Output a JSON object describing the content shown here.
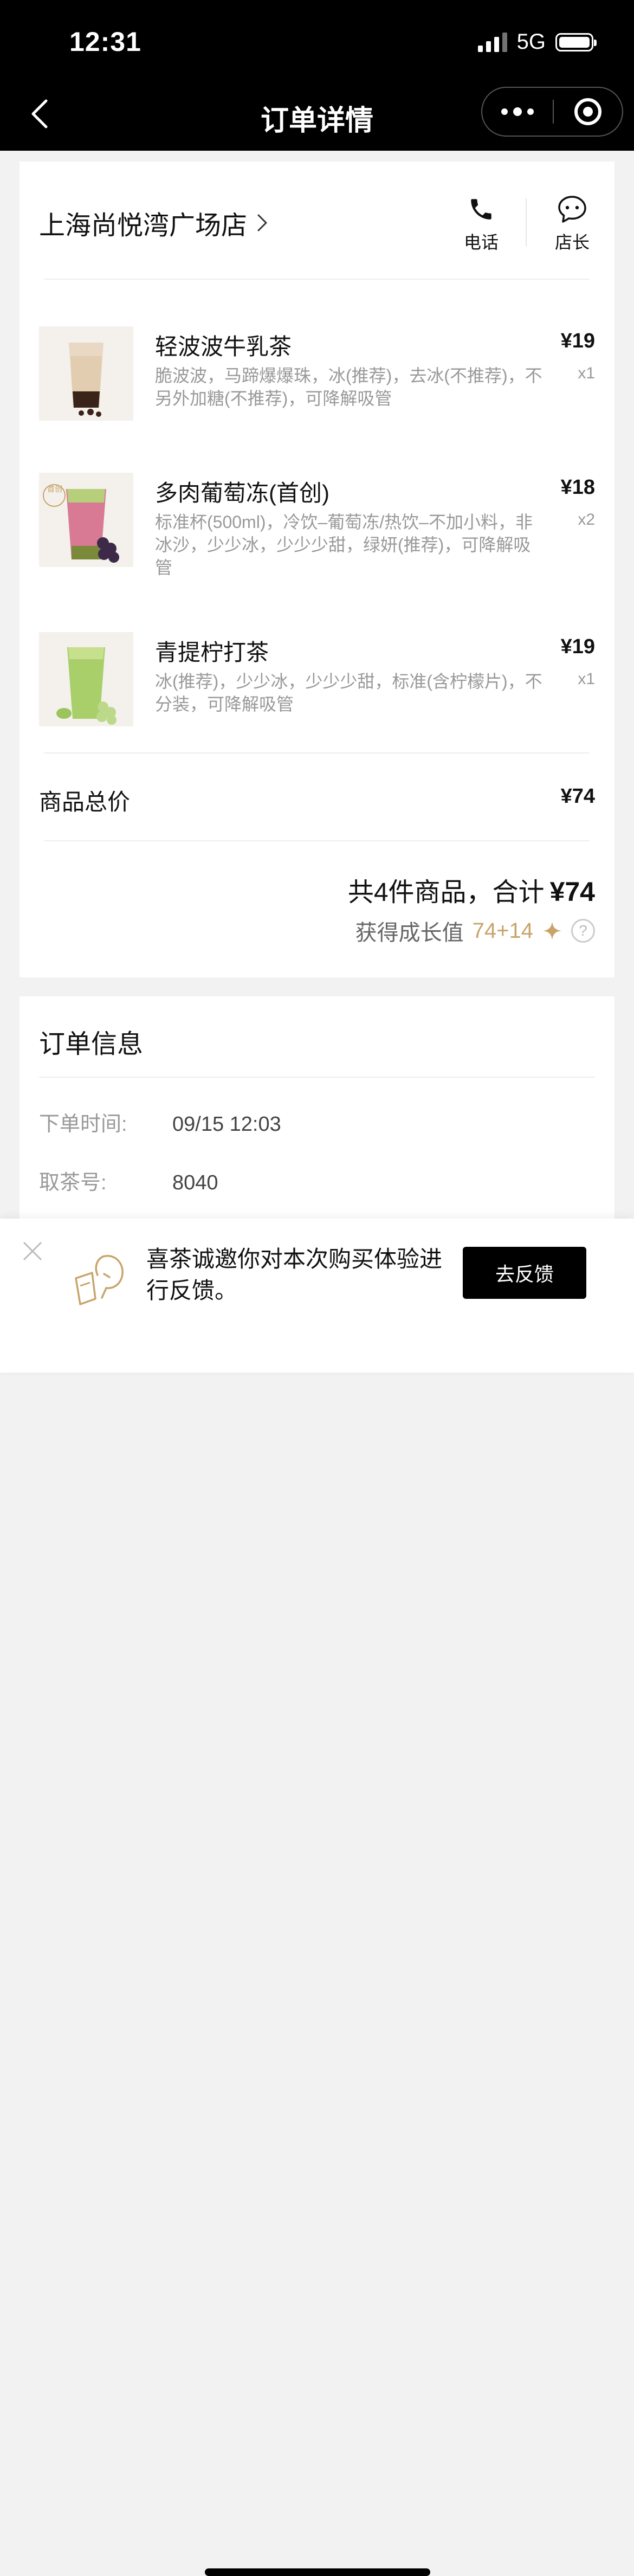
{
  "status_bar": {
    "time": "12:31",
    "network": "5G"
  },
  "nav": {
    "title": "订单详情"
  },
  "store": {
    "name": "上海尚悦湾广场店",
    "phone_label": "电话",
    "manager_label": "店长"
  },
  "items": [
    {
      "name": "轻波波牛乳茶",
      "desc": "脆波波，马蹄爆爆珠，冰(推荐)，去冰(不推荐)，不另外加糖(不推荐)，可降解吸管",
      "price": "¥19",
      "qty": "x1",
      "badge": ""
    },
    {
      "name": "多肉葡萄冻(首创)",
      "desc": "标准杯(500ml)，冷饮–葡萄冻/热饮–不加小料，非冰沙，少少冰，少少少甜，绿妍(推荐)，可降解吸管",
      "price": "¥18",
      "qty": "x2",
      "badge": "首创"
    },
    {
      "name": "青提柠打茶",
      "desc": "冰(推荐)，少少冰，少少少甜，标准(含柠檬片)，不分装，可降解吸管",
      "price": "¥19",
      "qty": "x1",
      "badge": ""
    }
  ],
  "summary": {
    "subtotal_label": "商品总价",
    "subtotal_value": "¥74",
    "total_prefix": "共4件商品，合计",
    "total_amount": "¥74",
    "growth_label": "获得成长值",
    "growth_value": "74+14",
    "help_icon": "?"
  },
  "order_info": {
    "title": "订单信息",
    "rows": [
      {
        "label": "下单时间:",
        "value": "09/15 12:03"
      },
      {
        "label": "取茶号:",
        "value": "8040"
      }
    ]
  },
  "feedback": {
    "text": "喜茶诚邀你对本次购买体验进行反馈。",
    "button": "去反馈"
  },
  "colors": {
    "accent_gold": "#c8a46a",
    "topbar": "#000000"
  }
}
